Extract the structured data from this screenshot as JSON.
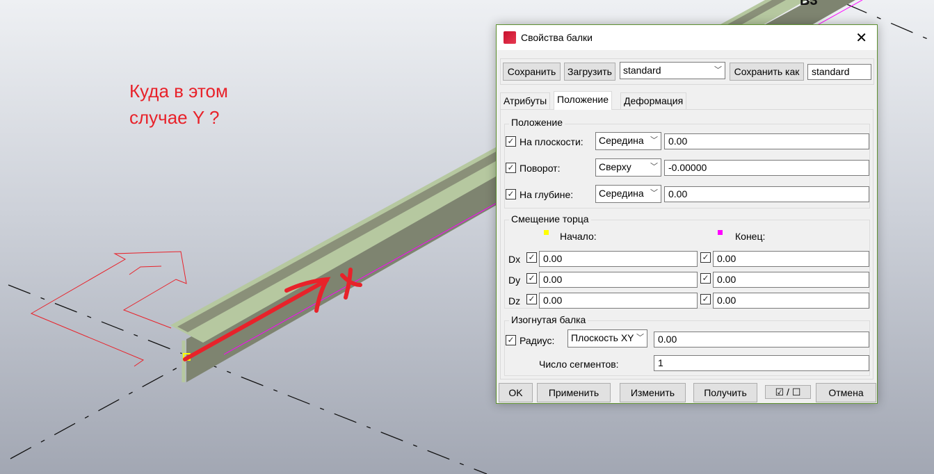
{
  "viewport": {
    "label_b3": "B3",
    "annotation": "Куда в этом случае Y ?",
    "axis_label": "X"
  },
  "dialog": {
    "title": "Свойства балки",
    "toolbar": {
      "save": "Сохранить",
      "load": "Загрузить",
      "preset": "standard",
      "save_as": "Сохранить как",
      "save_as_name": "standard"
    },
    "tabs": [
      {
        "label": "Атрибуты",
        "active": false
      },
      {
        "label": "Положение",
        "active": true
      },
      {
        "label": "Деформация",
        "active": false
      }
    ],
    "position": {
      "group": "Положение",
      "rows": [
        {
          "label": "На плоскости:",
          "checked": true,
          "option": "Середина",
          "value": "0.00"
        },
        {
          "label": "Поворот:",
          "checked": true,
          "option": "Сверху",
          "value": "-0.00000"
        },
        {
          "label": "На глубине:",
          "checked": true,
          "option": "Середина",
          "value": "0.00"
        }
      ]
    },
    "end_offset": {
      "group": "Смещение торца",
      "start": "Начало:",
      "end": "Конец:",
      "start_color": "#ffff00",
      "end_color": "#ff00ff",
      "rows": [
        {
          "label": "Dx",
          "start": "0.00",
          "end": "0.00"
        },
        {
          "label": "Dy",
          "start": "0.00",
          "end": "0.00"
        },
        {
          "label": "Dz",
          "start": "0.00",
          "end": "0.00"
        }
      ]
    },
    "curved": {
      "group": "Изогнутая балка",
      "radius_label": "Радиус:",
      "plane": "Плоскость XY",
      "radius": "0.00",
      "segments_label": "Число сегментов:",
      "segments": "1"
    },
    "footer": {
      "ok": "OK",
      "apply": "Применить",
      "modify": "Изменить",
      "get": "Получить",
      "toggle": "☑ / ☐",
      "cancel": "Отмена"
    }
  }
}
